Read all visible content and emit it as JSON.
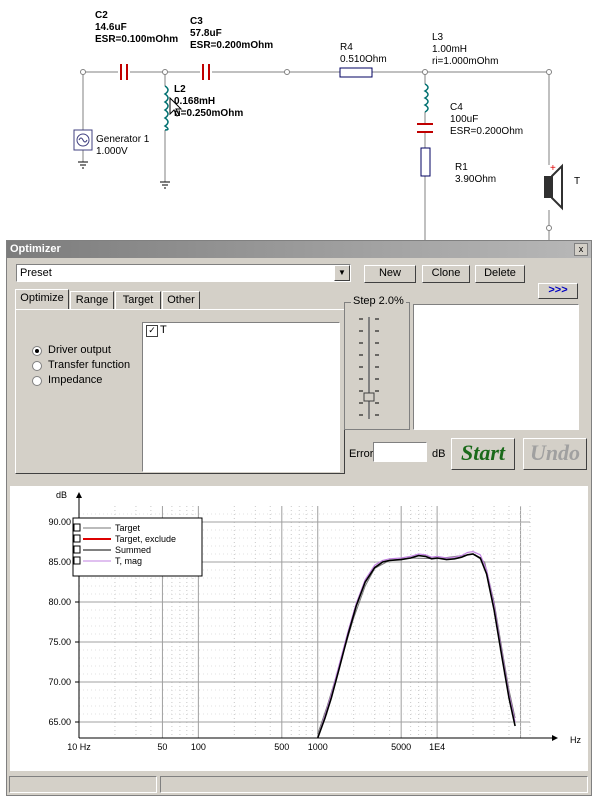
{
  "schematic": {
    "c2": {
      "name": "C2",
      "value": "14.6uF",
      "esr": "ESR=0.100mOhm"
    },
    "c3": {
      "name": "C3",
      "value": "57.8uF",
      "esr": "ESR=0.200mOhm"
    },
    "r4": {
      "name": "R4",
      "value": "0.510Ohm"
    },
    "l3": {
      "name": "L3",
      "value": "1.00mH",
      "ri": "ri=1.000mOhm"
    },
    "l2": {
      "name": "L2",
      "value": "0.168mH",
      "ri": "ri=0.250mOhm"
    },
    "c4": {
      "name": "C4",
      "value": "100uF",
      "esr": "ESR=0.200Ohm"
    },
    "r1": {
      "name": "R1",
      "value": "3.90Ohm"
    },
    "generator": {
      "name": "Generator 1",
      "value": "1.000V"
    },
    "speaker": {
      "name": "T"
    }
  },
  "optimizer": {
    "title": "Optimizer",
    "close": "x",
    "preset_value": "Preset",
    "buttons": {
      "new": "New",
      "clone": "Clone",
      "delete": "Delete",
      "more": ">>>",
      "start": "Start",
      "undo": "Undo"
    },
    "tabs": [
      "Optimize",
      "Range",
      "Target",
      "Other"
    ],
    "radios": [
      "Driver output",
      "Transfer function",
      "Impedance"
    ],
    "selected_radio": 0,
    "drivers": [
      {
        "label": "T",
        "checked": true
      }
    ],
    "step_label": "Step 2.0%",
    "error_label": "Error",
    "error_value": "",
    "error_unit": "dB"
  },
  "chart_data": {
    "type": "line",
    "ylabel": "dB",
    "xlabel": "Hz",
    "x_scale": "log",
    "xlim": [
      10,
      60000
    ],
    "ylim": [
      63,
      92
    ],
    "x_ticks": [
      "10 Hz",
      "50",
      "100",
      "500",
      "1000",
      "5000",
      "1E4"
    ],
    "y_ticks": [
      "90.00",
      "85.00",
      "80.00",
      "75.00",
      "70.00",
      "65.00"
    ],
    "legend": [
      "Target",
      "Target, exclude",
      "Summed",
      "T, mag"
    ],
    "legend_position": "top-left",
    "colors": {
      "target": "#777777",
      "exclude": "#dd0000",
      "summed": "#000000",
      "tmag": "#c080e0"
    },
    "series": [
      {
        "name": "Summed",
        "x": [
          1000,
          1150,
          1300,
          1500,
          1800,
          2100,
          2500,
          3000,
          3500,
          4000,
          5000,
          6000,
          7000,
          8000,
          9000,
          10000,
          12000,
          14000,
          16000,
          18000,
          20000,
          23000,
          26000,
          30000,
          35000,
          40000,
          45000
        ],
        "values": [
          63,
          65.5,
          68,
          71.5,
          76,
          79.5,
          82.5,
          84.3,
          85,
          85.2,
          85.3,
          85.5,
          85.8,
          85.7,
          85.4,
          85.5,
          85.3,
          85.4,
          85.6,
          85.9,
          86.0,
          85.5,
          83.5,
          79,
          73,
          68,
          64.5
        ]
      },
      {
        "name": "T, mag",
        "x": [
          1000,
          1150,
          1300,
          1500,
          1800,
          2100,
          2500,
          3000,
          3500,
          4000,
          5000,
          6000,
          7000,
          8000,
          9000,
          10000,
          12000,
          14000,
          16000,
          18000,
          20000,
          23000,
          26000,
          30000,
          35000,
          40000,
          45000
        ],
        "values": [
          63,
          65.8,
          68.4,
          72,
          76.4,
          79.8,
          82.8,
          84.6,
          85.2,
          85.4,
          85.5,
          85.7,
          86.0,
          85.9,
          85.6,
          85.7,
          85.5,
          85.6,
          85.8,
          86.2,
          86.3,
          85.9,
          84,
          79.6,
          73.5,
          68.5,
          65
        ]
      },
      {
        "name": "Target",
        "x": [
          1000,
          1200,
          1500,
          2000,
          2500,
          3000,
          4000,
          6000,
          10000,
          16000,
          20000,
          25000,
          30000,
          35000,
          40000,
          45000
        ],
        "values": [
          63.5,
          67,
          71.8,
          78,
          82,
          84.2,
          85.2,
          85.5,
          85.4,
          85.8,
          86,
          85,
          80,
          74,
          69,
          65.5
        ]
      }
    ]
  }
}
